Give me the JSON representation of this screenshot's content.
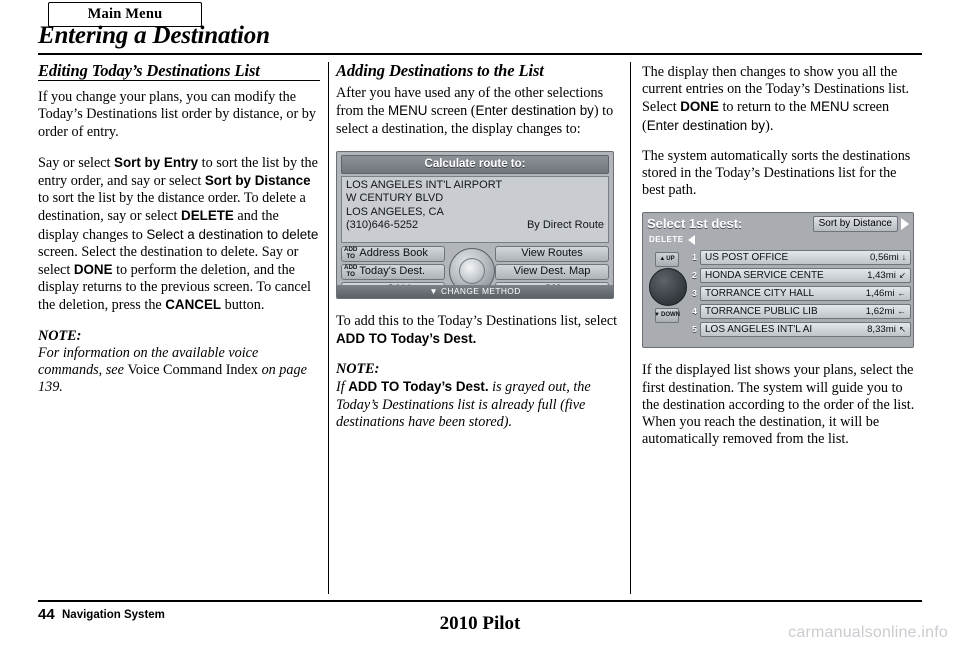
{
  "header": {
    "main_menu_tab": "Main Menu",
    "page_title": "Entering a Destination"
  },
  "col1": {
    "section_heading": "Editing Today’s Destinations List",
    "p1": "If you change your plans, you can modify the Today’s Destinations list order by distance, or by order of entry.",
    "p2_a": "Say or select ",
    "p2_b_bold": "Sort by Entry",
    "p2_c": " to sort the list by the entry order, and say or select ",
    "p2_d_bold": "Sort by Distance",
    "p2_e": " to sort the list by the distance order. To delete a destination, say or select ",
    "p2_f_bold": "DELETE",
    "p2_g": " and the display changes to ",
    "p2_h_bold": "Select a destination to delete",
    "p2_i": " screen. Select the destination to delete. Say or select ",
    "p2_j_bold": "DONE",
    "p2_k": " to perform the deletion, and the display returns to the previous screen. To cancel the deletion, press the ",
    "p2_l_bold": "CANCEL",
    "p2_m": " button.",
    "note_label": "NOTE:",
    "note_a": "For information on the available voice commands, see ",
    "note_b_regular": "Voice Command Index",
    "note_c": " on page ",
    "note_page": "139",
    "note_d": "."
  },
  "col2": {
    "section_heading": "Adding Destinations to the List",
    "p1_a": "After you have used any of the other selections from the ",
    "p1_b_sans": "MENU",
    "p1_c": " screen (",
    "p1_d_sans": "Enter destination by",
    "p1_e": ") to select a destination, the display changes to:",
    "p2_a": "To add this to the Today’s Destinations list, select ",
    "p2_b_bold": "ADD TO Today’s Dest.",
    "note_label": "NOTE:",
    "note_if": "If ",
    "note_b_bold": "ADD TO Today’s Dest.",
    "note_c": " is grayed out, the Today’s Destinations list is already full (five destinations have been stored)."
  },
  "screen_calc": {
    "title": "Calculate route to:",
    "address_lines": [
      "LOS ANGELES INT'L AIRPORT",
      "W CENTURY BLVD",
      "LOS ANGELES, CA"
    ],
    "phone": "(310)646-5252",
    "route_type": "By Direct Route",
    "buttons": {
      "add_to_label": "ADD\nTO",
      "address_book": "Address Book",
      "todays_dest": "Today's Dest.",
      "view_routes": "View Routes",
      "view_dest_map": "View Dest. Map",
      "call": "CALL",
      "ok": "OK"
    },
    "change_method": "CHANGE METHOD"
  },
  "col3": {
    "p1_a": "The display then changes to show you all the current entries on the Today’s Destinations list. Select ",
    "p1_b_bold": "DONE",
    "p1_c": " to return to the ",
    "p1_d_sans": "MENU",
    "p1_e": " screen (",
    "p1_f_sans": "Enter destination by",
    "p1_g": ").",
    "p2": "The system automatically sorts the destinations stored in the Today’s Destinations list for the best path.",
    "p3": "If the displayed list shows your plans, select the first destination. The system will guide you to the destination according to the order of the list. When you reach the destination, it will be automatically removed from the list."
  },
  "screen_select": {
    "title": "Select 1st dest:",
    "sort_button": "Sort by Distance",
    "delete_label": "DELETE",
    "up_label": "UP",
    "down_label": "DOWN",
    "rows": [
      {
        "index": "1",
        "name": "US POST OFFICE",
        "distance": "0,56mi",
        "dir": "↓"
      },
      {
        "index": "2",
        "name": "HONDA SERVICE CENTE",
        "distance": "1,43mi",
        "dir": "↙"
      },
      {
        "index": "3",
        "name": "TORRANCE CITY HALL",
        "distance": "1,46mi",
        "dir": "←"
      },
      {
        "index": "4",
        "name": "TORRANCE PUBLIC LIB",
        "distance": "1,62mi",
        "dir": "←"
      },
      {
        "index": "5",
        "name": "LOS ANGELES INT'L AI",
        "distance": "8,33mi",
        "dir": "↖"
      }
    ]
  },
  "footer": {
    "page_number": "44",
    "label": "Navigation System",
    "model": "2010 Pilot",
    "watermark": "carmanualsonline.info"
  }
}
